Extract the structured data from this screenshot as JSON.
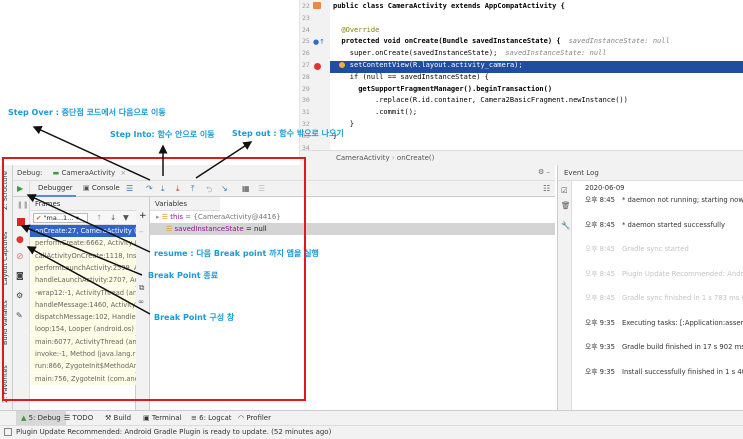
{
  "editor": {
    "lines": [
      {
        "n": "22",
        "code": "public class CameraActivity extends AppCompatActivity {"
      },
      {
        "n": "23",
        "code": ""
      },
      {
        "n": "24",
        "code": "@Override"
      },
      {
        "n": "25",
        "code": "protected void onCreate(Bundle savedInstanceState) {",
        "hint": "savedInstanceState: null"
      },
      {
        "n": "26",
        "code": "super.onCreate(savedInstanceState);",
        "hint": "savedInstanceState: null"
      },
      {
        "n": "27",
        "code": "setContentView(R.layout.activity_camera);"
      },
      {
        "n": "28",
        "code": "if (null == savedInstanceState) {"
      },
      {
        "n": "29",
        "code": "getSupportFragmentManager().beginTransaction()"
      },
      {
        "n": "30",
        "code": ".replace(R.id.container, Camera2BasicFragment.newInstance())"
      },
      {
        "n": "31",
        "code": ".commit();"
      },
      {
        "n": "32",
        "code": "}"
      },
      {
        "n": "33",
        "code": "}"
      },
      {
        "n": "34",
        "code": ""
      }
    ],
    "breadcrumb": [
      "CameraActivity",
      "onCreate()"
    ]
  },
  "side_tools": [
    "Z: Structure",
    "Layout Captures",
    "Build Variants",
    "2: Favorites"
  ],
  "debug": {
    "label": "Debug:",
    "config": "CameraActivity",
    "tab_debugger": "Debugger",
    "tab_console": "Console",
    "frames_header": "Frames",
    "variables_header": "Variables",
    "thread": "\"ma...1...",
    "frames": [
      "onCreate:27, CameraActivity (c",
      "performCreate:6662, Activity (a",
      "callActivityOnCreate:1118, Inst",
      "performLaunchActivity:2599, A",
      "handleLaunchActivity:2707, Ac",
      "-wrap12:-1, ActivityThread (an",
      "handleMessage:1460, ActivityT",
      "dispatchMessage:102, Handler",
      "loop:154, Looper (android.os)",
      "main:6077, ActivityThread (an",
      "invoke:-1, Method (java.lang.r",
      "run:866, ZygoteInit$MethodAn",
      "main:756, ZygoteInit (com.and"
    ],
    "variables": [
      {
        "name": "this",
        "value": "= {CameraActivity@4416}"
      },
      {
        "name": "savedInstanceState",
        "value": "= null"
      }
    ]
  },
  "annotations": {
    "step_over": "Step Over : 중단점 코드에서 다음으로 이동",
    "step_into": "Step Into: 함수 안으로 이동",
    "step_out": "Step out : 함수 밖으로 나오기",
    "resume": "resume :  다음 Break point 까지 앱을 실행",
    "stop": "Break Point 종료",
    "view_bp": "Break Point 구성 창"
  },
  "event_log": {
    "title": "Event Log",
    "date": "2020-06-09",
    "entries": [
      {
        "time": "오후 8:45",
        "msg": "* daemon not running; starting now a",
        "dim": false
      },
      {
        "time": "오후 8:45",
        "msg": "* daemon started successfully",
        "dim": false
      },
      {
        "time": "오후 8:45",
        "msg": "Gradle sync started",
        "dim": true
      },
      {
        "time": "오후 8:45",
        "msg": "Plugin Update Recommended: Andr",
        "dim": true
      },
      {
        "time": "오후 8:45",
        "msg": "Gradle sync finished in 1 s 783 ms (fr",
        "dim": true
      },
      {
        "time": "오후 9:35",
        "msg": "Executing tasks: [:Application:assemble",
        "dim": false
      },
      {
        "time": "오후 9:35",
        "msg": "Gradle build finished in 17 s 902 ms",
        "dim": false
      },
      {
        "time": "오후 9:35",
        "msg": "Install successfully finished in 1 s 409",
        "dim": false
      }
    ]
  },
  "bottom_tabs": [
    "5: Debug",
    "TODO",
    "Build",
    "Terminal",
    "6: Logcat",
    "Profiler"
  ],
  "status": "Plugin Update Recommended: Android Gradle Plugin is ready to update. (52 minutes ago)"
}
